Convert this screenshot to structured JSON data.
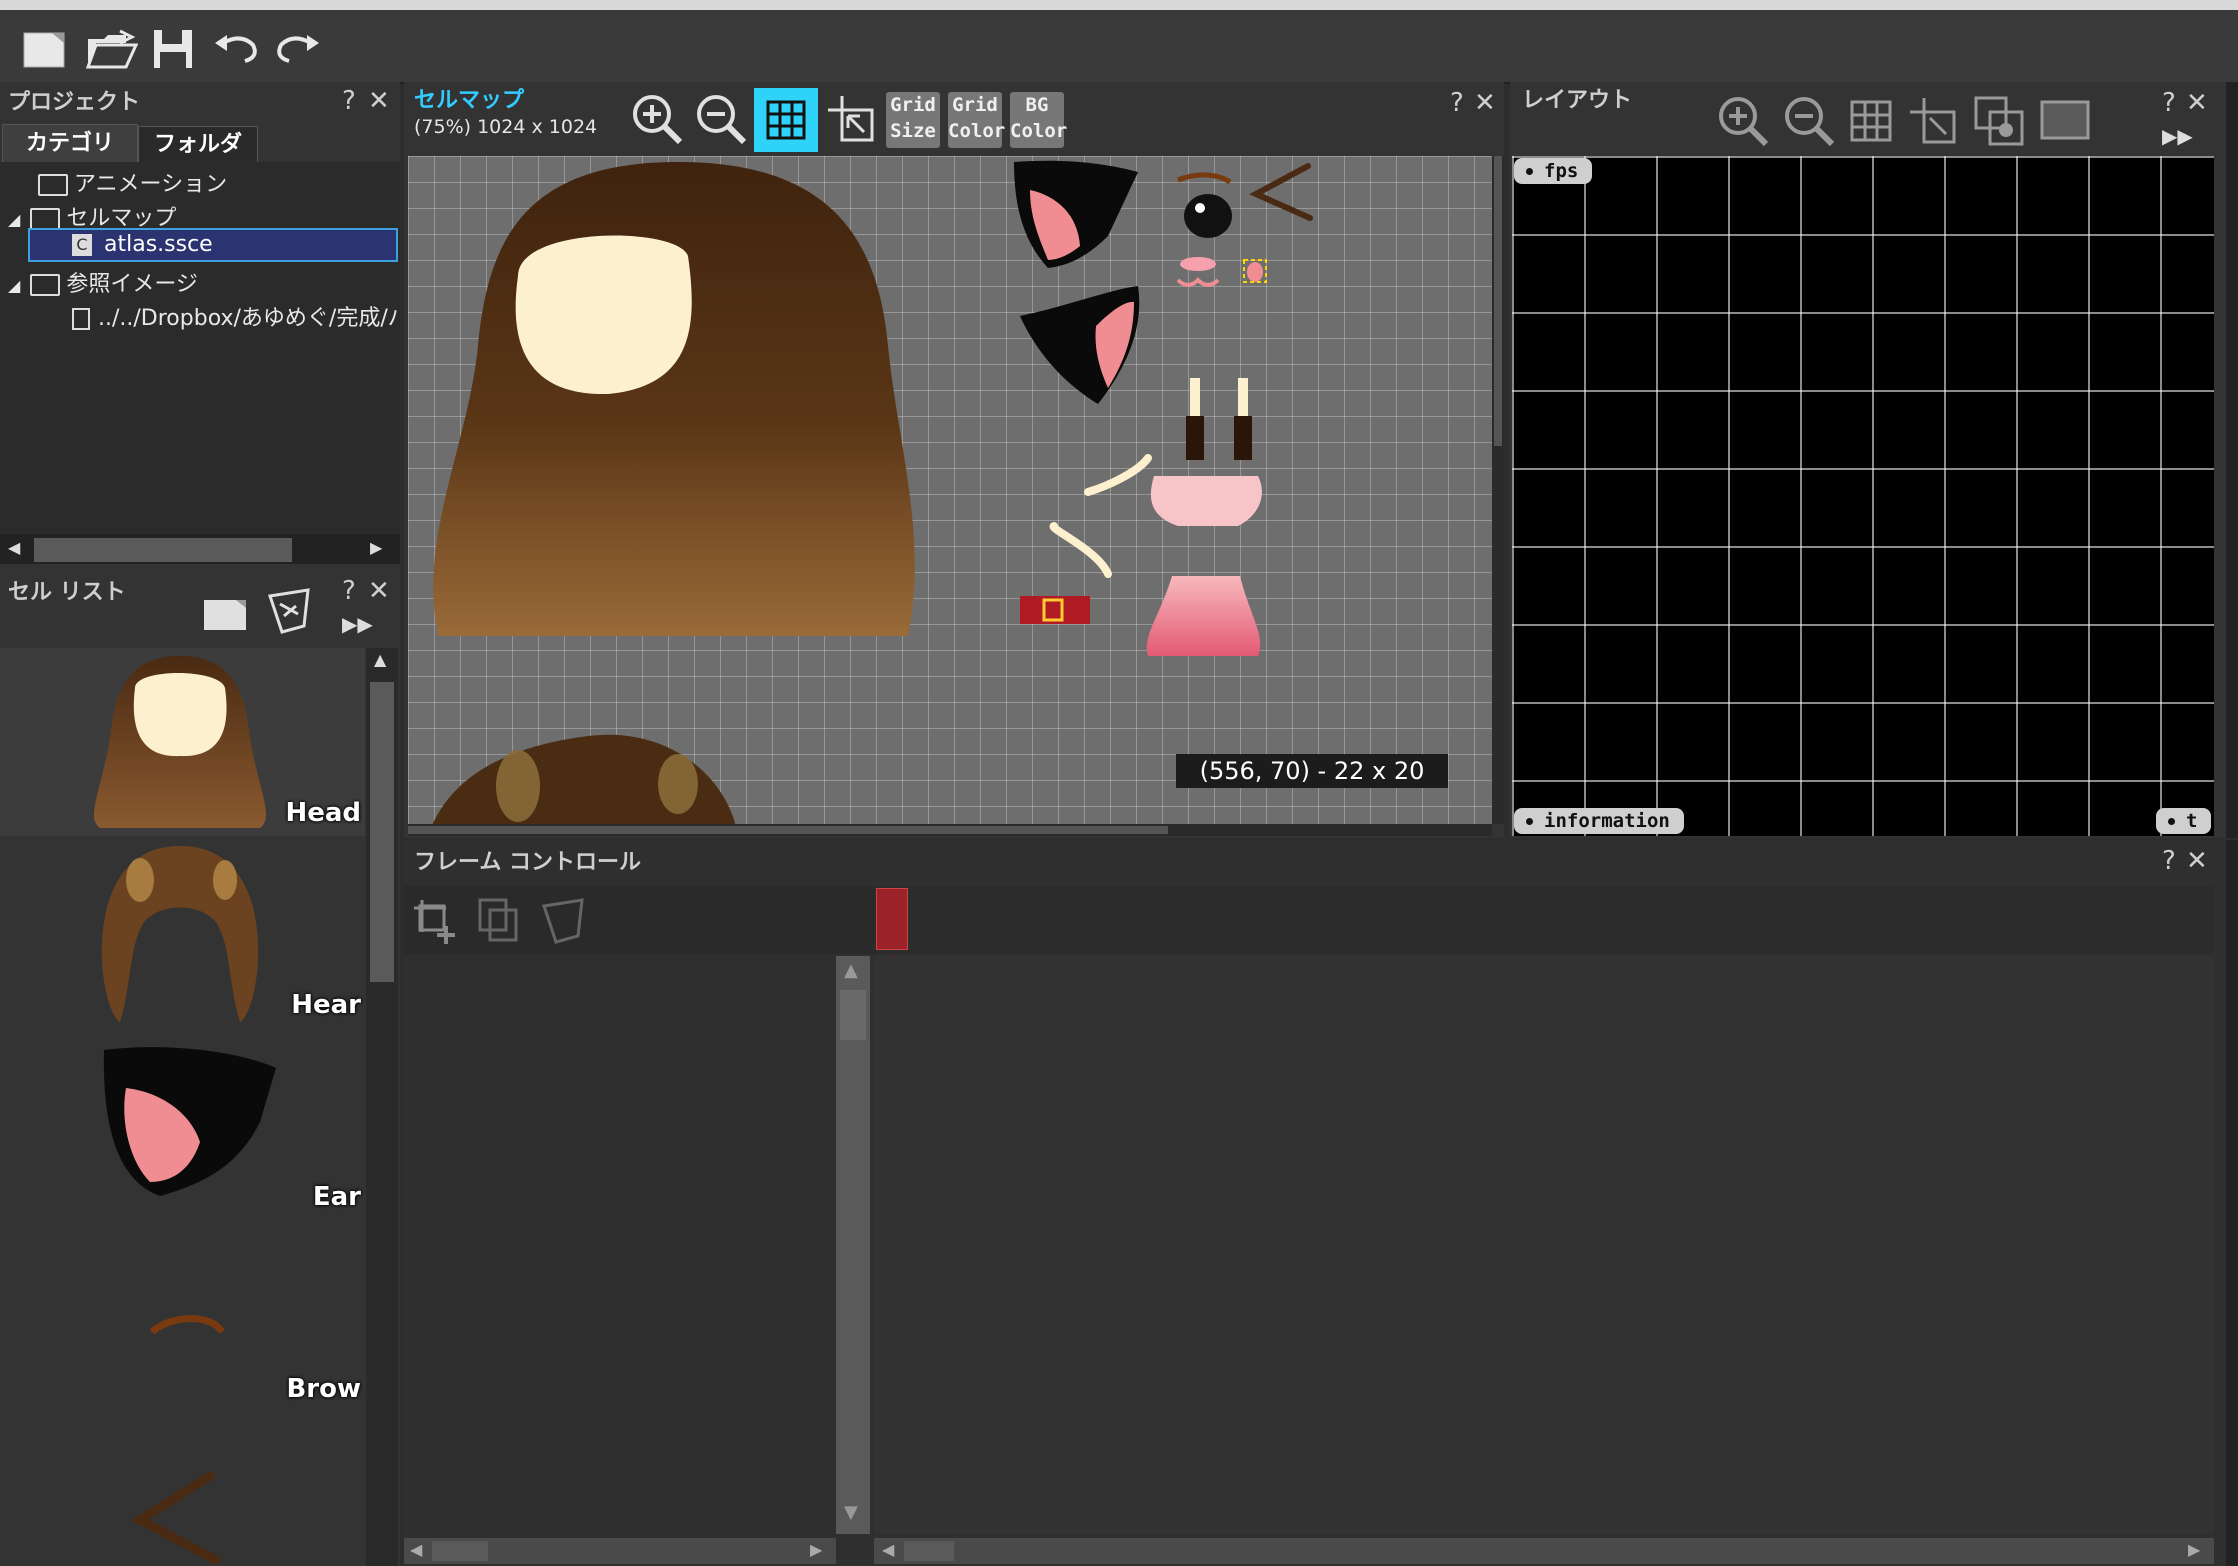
{
  "project": {
    "title": "プロジェクト",
    "tabs": [
      "カテゴリ",
      "フォルダ"
    ],
    "tree": [
      {
        "label": "アニメーション"
      },
      {
        "label": "セルマップ"
      },
      {
        "label": "atlas.ssce"
      },
      {
        "label": "参照イメージ"
      },
      {
        "label": "../../Dropbox/あゆめぐ/完成/パ"
      }
    ]
  },
  "cellmap": {
    "title": "セルマップ",
    "subtitle": "(75%) 1024 x 1024",
    "buttons": [
      "Grid Size",
      "Grid Color",
      "BG Color"
    ],
    "grid_size_top": "Grid",
    "grid_size_bottom": "Size",
    "grid_color_top": "Grid",
    "grid_color_bottom": "Color",
    "bg_color_top": "BG",
    "bg_color_bottom": "Color",
    "selection_info": "(556, 70) - 22 x 20"
  },
  "layout": {
    "title": "レイアウト",
    "fps_label": "fps",
    "info_label": "information",
    "right_tab_label": "t"
  },
  "cell_list": {
    "title": "セル リスト",
    "items": [
      {
        "label": "Head"
      },
      {
        "label": "Hear"
      },
      {
        "label": "Ear"
      },
      {
        "label": "Brow"
      },
      {
        "label": ""
      }
    ]
  },
  "frame_control": {
    "title": "フレーム コントロール"
  },
  "window_controls": {
    "help": "?",
    "close": "✕"
  },
  "colors": {
    "accent": "#33ccff",
    "panel_bg": "#2d2d2d",
    "selected_row": "#2b3370",
    "keyframe": "#9b2228"
  }
}
